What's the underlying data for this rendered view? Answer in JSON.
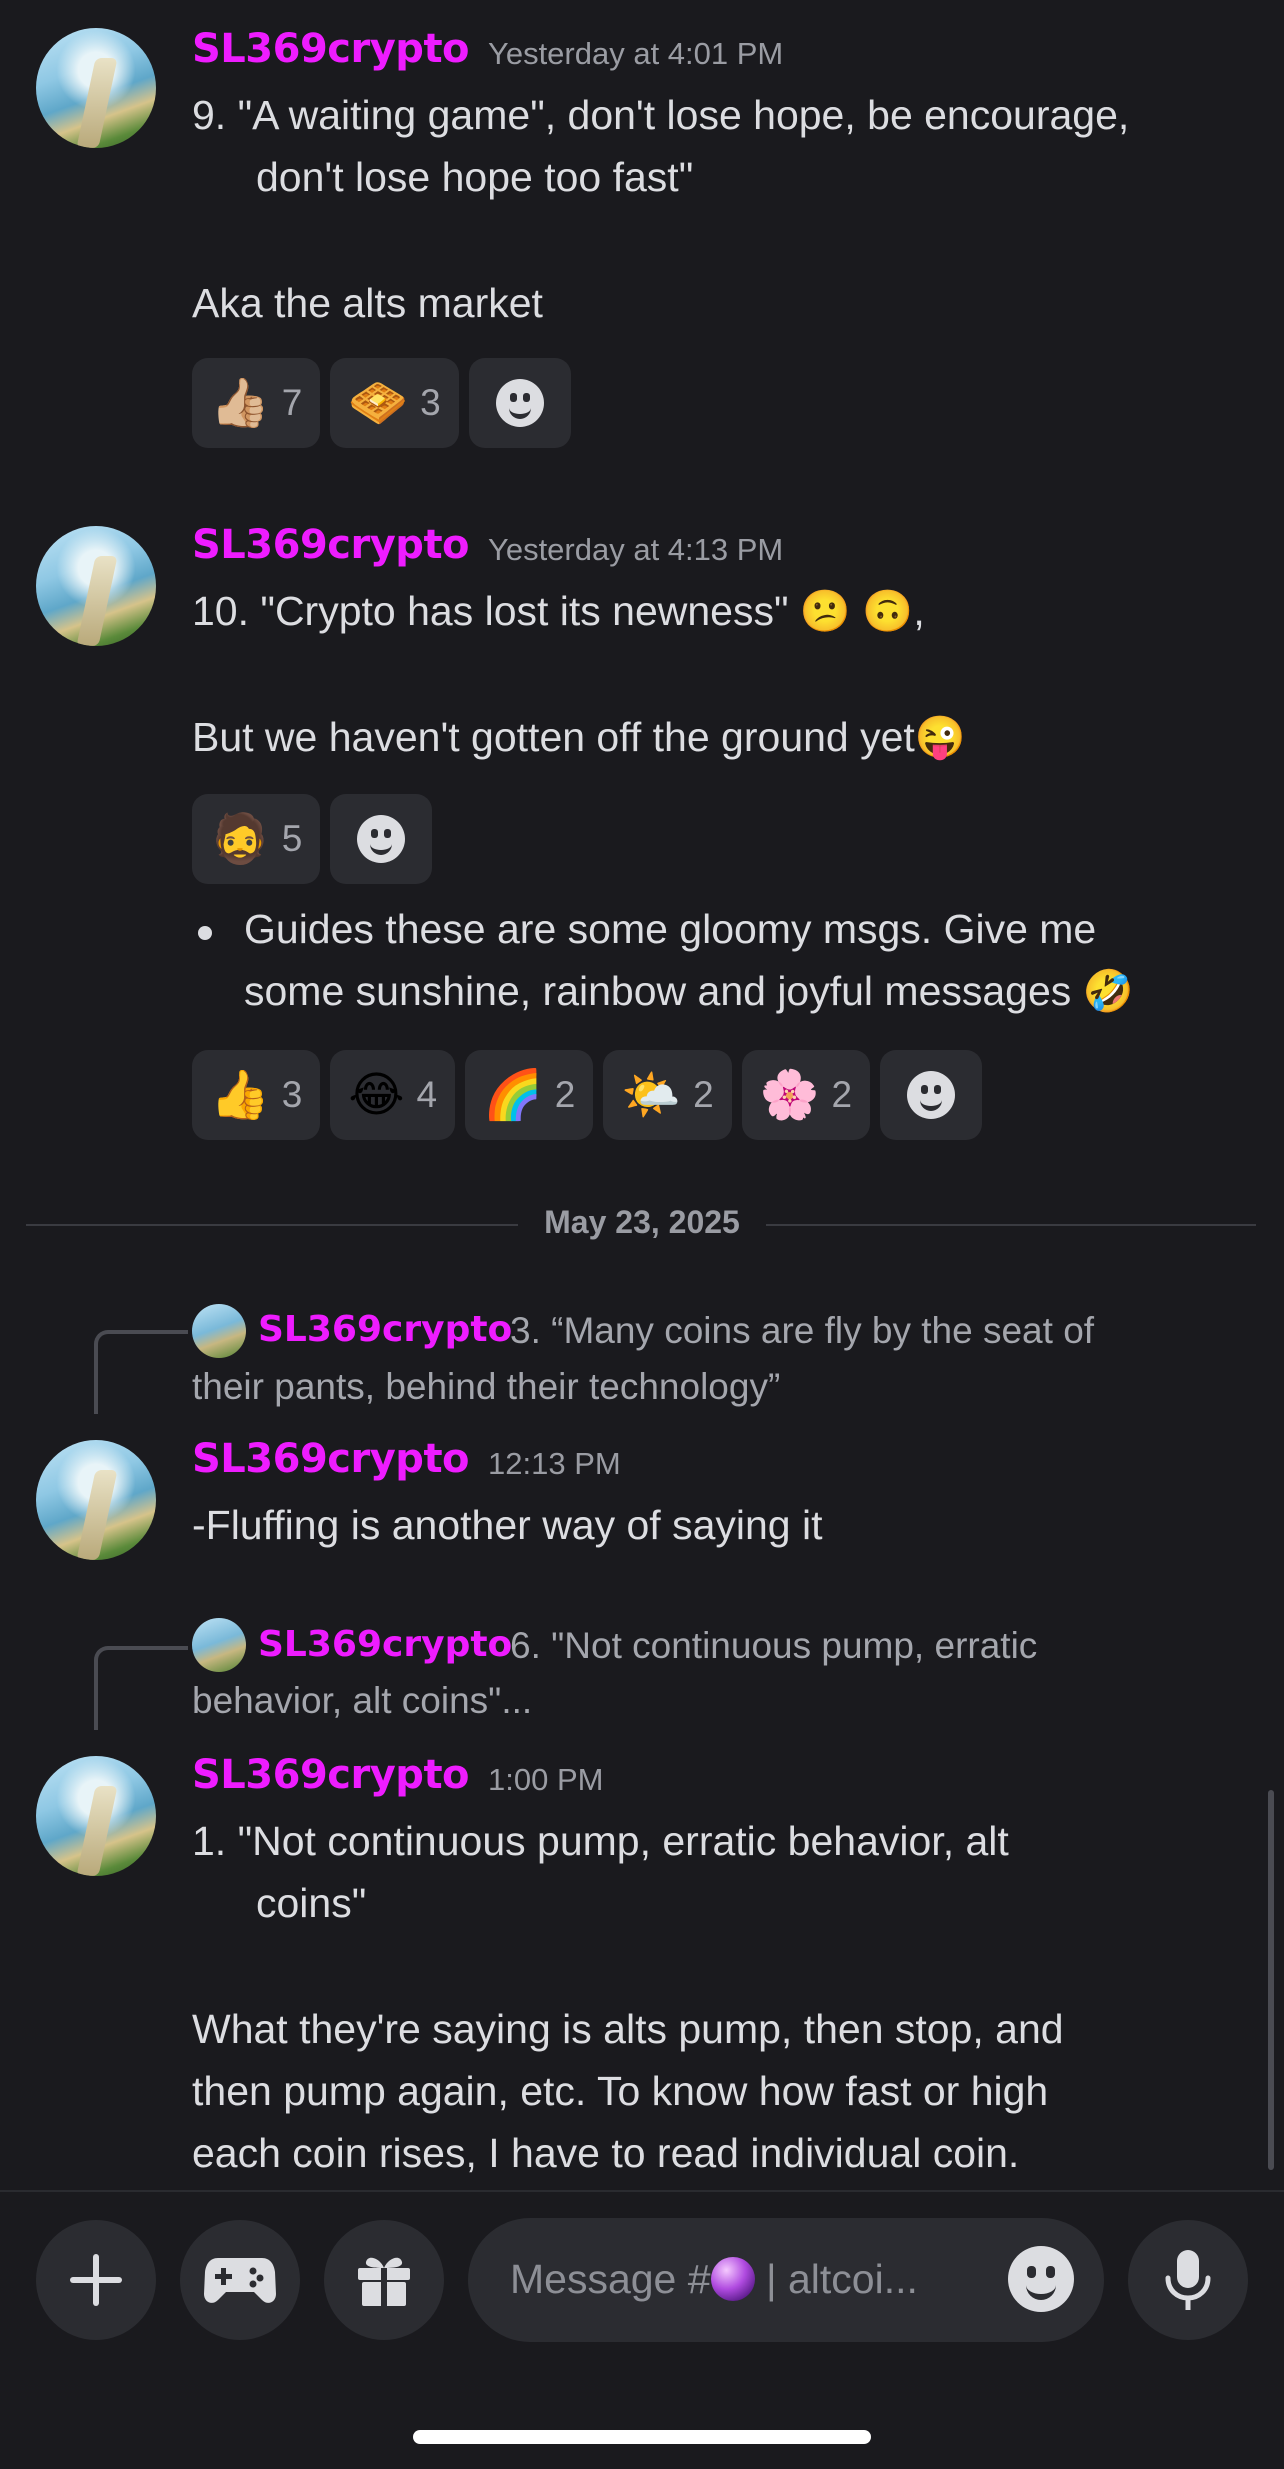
{
  "messages": [
    {
      "author": "SL369crypto",
      "timestamp": "Yesterday at 4:01 PM",
      "lines": [
        "9.  \"A waiting game\", don't lose hope, be encourage,",
        "don't lose hope too fast\"",
        "Aka the alts market"
      ],
      "reactions": [
        {
          "emoji": "👍🏼",
          "count": "7"
        },
        {
          "emoji": "🧇",
          "count": "3"
        }
      ]
    },
    {
      "author": "SL369crypto",
      "timestamp": "Yesterday at 4:13 PM",
      "lines": [
        "10.  \"Crypto has lost its newness\" 😕 🙃,",
        "But we haven't gotten off the ground yet😜"
      ],
      "reactions": [
        {
          "emoji": "🧔",
          "count": "5"
        }
      ],
      "bullet_lines": [
        "Guides these are some gloomy msgs.  Give me",
        "some sunshine, rainbow and joyful messages 🤣"
      ],
      "bullet_reactions": [
        {
          "emoji": "👍",
          "count": "3"
        },
        {
          "emoji": "😂",
          "count": "4"
        },
        {
          "emoji": "🌈",
          "count": "2"
        },
        {
          "emoji": "🌤️",
          "count": "2"
        },
        {
          "emoji": "🌸",
          "count": "2"
        }
      ]
    }
  ],
  "date_divider": "May 23, 2025",
  "replies": [
    {
      "reply_to_author": "SL369crypto",
      "reply_to_text_1": "3.  “Many coins are fly by the seat of",
      "reply_to_text_2": "their pants, behind their technology”",
      "author": "SL369crypto",
      "timestamp": "12:13 PM",
      "lines": [
        "-Fluffing is another way of saying it"
      ]
    },
    {
      "reply_to_author": "SL369crypto",
      "reply_to_text_1": "6.  \"Not continuous pump, erratic",
      "reply_to_text_2": "behavior, alt coins\"...",
      "author": "SL369crypto",
      "timestamp": "1:00 PM",
      "lines": [
        "1.  \"Not continuous pump, erratic  behavior, alt",
        "coins\"",
        "What they're saying is alts pump, then stop, and",
        "then pump again, etc. To know how fast or high",
        "each coin rises, I have to read individual coin."
      ]
    }
  ],
  "composer": {
    "placeholder_prefix": "Message #",
    "placeholder_suffix": "  |  altcoi..."
  },
  "icons": [
    "plus-icon",
    "gamepad-icon",
    "gift-icon",
    "emoji-icon",
    "microphone-icon"
  ]
}
